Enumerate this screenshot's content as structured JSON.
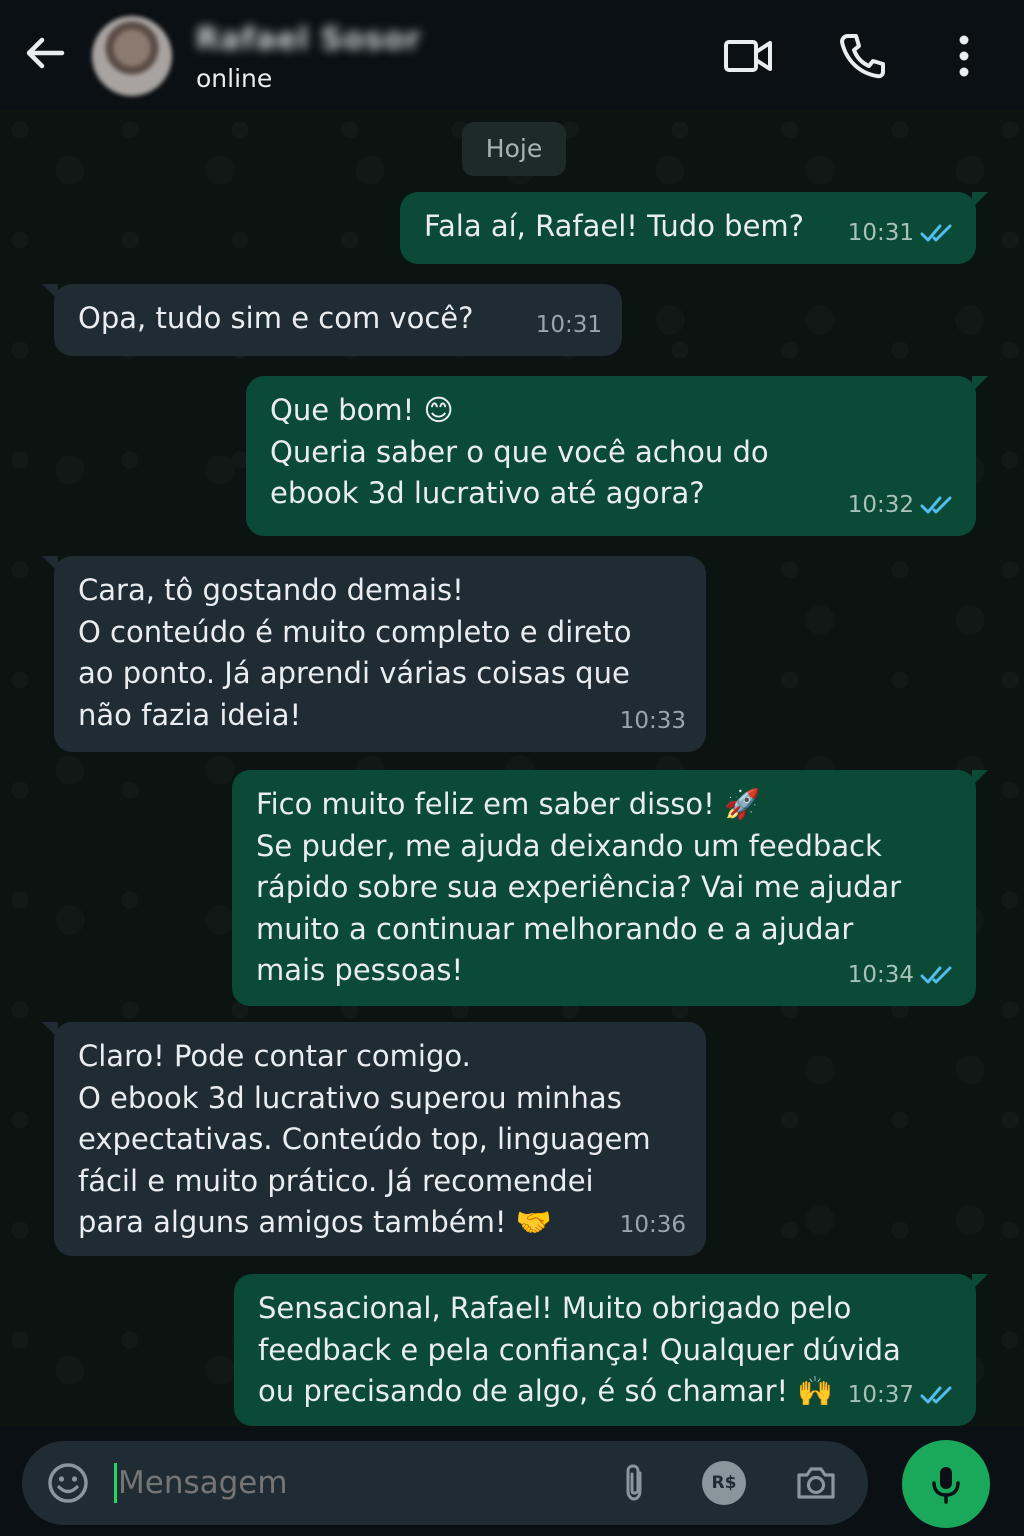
{
  "header": {
    "contact_name": "Rafael Sosor",
    "status": "online"
  },
  "chat": {
    "date_label": "Hoje",
    "messages": [
      {
        "direction": "out",
        "text": "Fala aí, Rafael! Tudo bem?",
        "time": "10:31",
        "read": true
      },
      {
        "direction": "in",
        "text": "Opa, tudo sim e com você?",
        "time": "10:31"
      },
      {
        "direction": "out",
        "text": "Que bom! 😊\nQueria saber o que você achou do\nebook 3d lucrativo até agora?",
        "time": "10:32",
        "read": true
      },
      {
        "direction": "in",
        "text": "Cara, tô gostando demais!\nO conteúdo é muito completo e direto\nao ponto. Já aprendi várias coisas que\nnão fazia ideia!",
        "time": "10:33"
      },
      {
        "direction": "out",
        "text": "Fico muito feliz em saber disso! 🚀\nSe puder, me ajuda deixando um feedback\nrápido sobre sua experiência? Vai me ajudar\nmuito a continuar melhorando e a ajudar\nmais pessoas!",
        "time": "10:34",
        "read": true
      },
      {
        "direction": "in",
        "text": "Claro! Pode contar comigo.\nO ebook 3d lucrativo superou minhas\nexpectativas. Conteúdo top, linguagem\nfácil e muito prático. Já recomendei\npara alguns amigos também! 🤝",
        "time": "10:36"
      },
      {
        "direction": "out",
        "text": "Sensacional, Rafael! Muito obrigado pelo\nfeedback e pela confiança! Qualquer dúvida\nou precisando de algo, é só chamar! 🙌",
        "time": "10:37",
        "read": true
      }
    ]
  },
  "input": {
    "placeholder": "Mensagem",
    "payment_label": "R$"
  },
  "colors": {
    "outgoing_bubble": "#0b4a37",
    "incoming_bubble": "#1f2c33",
    "read_tick": "#53bdeb",
    "mic_button": "#1aa85a"
  },
  "icons": [
    "back-arrow-icon",
    "video-call-icon",
    "phone-icon",
    "more-options-icon",
    "emoji-icon",
    "attach-icon",
    "payment-icon",
    "camera-icon",
    "mic-icon",
    "double-check-icon"
  ]
}
